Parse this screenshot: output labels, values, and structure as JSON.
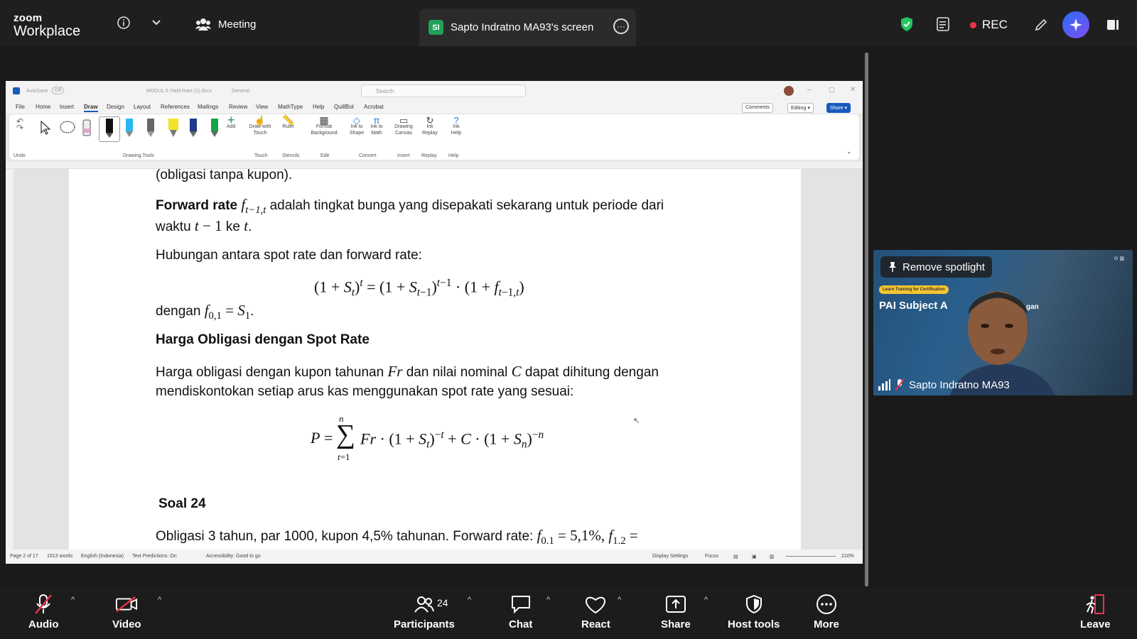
{
  "zoom": {
    "brand_line1": "zoom",
    "brand_line2": "Workplace",
    "meeting_label": "Meeting",
    "share_tab": {
      "badge": "SI",
      "label": "Sapto Indratno MA93's screen"
    },
    "rec_label": "REC",
    "accent_color": "#2e6cf6",
    "rec_color": "#e8344a"
  },
  "word": {
    "autosave_label": "AutoSave",
    "autosave_state": "Off",
    "doc_title": "MODUL 5 Yield Rate (1).docx",
    "sensitivity": "General",
    "search_placeholder": "Search",
    "menu": [
      "File",
      "Home",
      "Insert",
      "Draw",
      "Design",
      "Layout",
      "References",
      "Mailings",
      "Review",
      "View",
      "MathType",
      "Help",
      "QuillBot",
      "Acrobat"
    ],
    "active_menu": "Draw",
    "comments_label": "Comments",
    "editing_label": "Editing",
    "share_label": "Share",
    "ribbon": {
      "undo_group": "Undo",
      "drawing_tools_group": "Drawing Tools",
      "add_label": "Add",
      "draw_with_touch": "Draw with Touch",
      "ruler": "Ruler",
      "format_background": "Format Background",
      "ink_to_shape": "Ink to Shape",
      "ink_to_math": "Ink to Math",
      "drawing_canvas": "Drawing Canvas",
      "ink_replay": "Ink Replay",
      "ink_help": "Ink Help",
      "groups": [
        "Touch",
        "Stencils",
        "Edit",
        "Convert",
        "Insert",
        "Replay",
        "Help"
      ]
    },
    "document": {
      "line0": "(obligasi tanpa kupon).",
      "fwd_bold": "Forward rate",
      "fwd_rest": " adalah tingkat bunga yang disepakati sekarang untuk periode dari",
      "fwd_line2_a": "waktu ",
      "fwd_line2_b": " ke ",
      "hubungan": "Hubungan antara spot rate dan forward rate:",
      "dengan": "dengan ",
      "heading": "Harga Obligasi dengan Spot Rate",
      "harga_a": "Harga obligasi dengan kupon tahunan ",
      "harga_b": " dan nilai nominal ",
      "harga_c": " dapat dihitung dengan",
      "harga_line2": "mendiskontokan setiap arus kas menggunakan spot rate yang sesuai:",
      "soal": "Soal 24",
      "obligasi": "Obligasi 3 tahun, par 1000, kupon 4,5% tahunan. Forward rate: ",
      "obligasi_val1": "5,1%,"
    },
    "status": {
      "page": "Page 2 of 17",
      "words": "1513 words",
      "language": "English (Indonesia)",
      "predictions": "Text Predictions: On",
      "accessibility": "Accessibility: Good to go",
      "display_settings": "Display Settings",
      "focus": "Focus",
      "zoom": "210%"
    }
  },
  "video": {
    "remove_spotlight": "Remove spotlight",
    "banner_pill": "Learn Training for Certification",
    "banner_title": "PAI Subject A",
    "banner_tail": "gan",
    "participant_name": "Sapto Indratno MA93"
  },
  "toolbar": {
    "audio": "Audio",
    "video": "Video",
    "participants": "Participants",
    "participants_count": "24",
    "chat": "Chat",
    "react": "React",
    "share": "Share",
    "host_tools": "Host tools",
    "more": "More",
    "leave": "Leave",
    "leave_color": "#e8344a"
  }
}
